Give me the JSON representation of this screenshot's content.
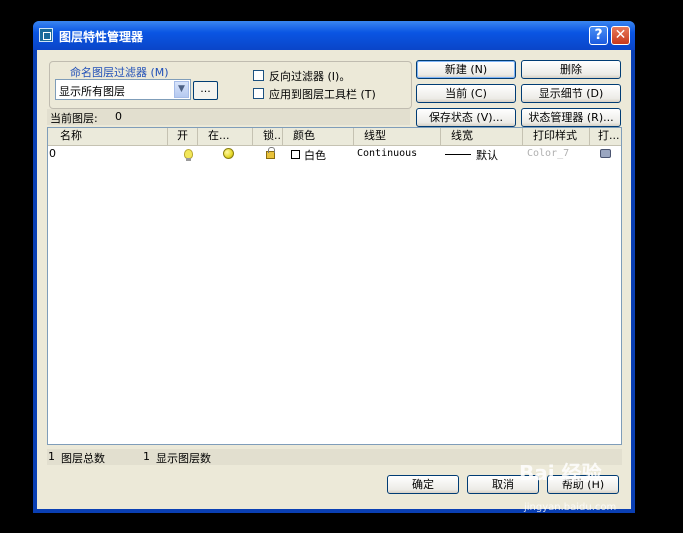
{
  "window": {
    "title": "图层特性管理器",
    "help_button": "?",
    "close_button": "✕"
  },
  "filter": {
    "group_label": "命名图层过滤器 (M)",
    "selected": "显示所有图层",
    "ellipsis": "...",
    "invert_label": "反向过滤器 (I)。",
    "apply_toolbar_label": "应用到图层工具栏 (T)"
  },
  "buttons": {
    "new": "新建 (N)",
    "delete": "删除",
    "current": "当前 (C)",
    "show_details": "显示细节 (D)",
    "save_state": "保存状态 (V)...",
    "state_manager": "状态管理器 (R)...",
    "ok": "确定",
    "cancel": "取消",
    "help": "帮助 (H)"
  },
  "current_layer": {
    "label": "当前图层:",
    "value": "0"
  },
  "table": {
    "columns": [
      "名称",
      "开",
      "在...",
      "锁...",
      "颜色",
      "线型",
      "线宽",
      "打印样式",
      "打..."
    ],
    "rows": [
      {
        "name": "0",
        "on": "bulb-icon",
        "freeze": "sun-icon",
        "lock": "lock-icon",
        "color": "白色",
        "linetype": "Continuous",
        "lineweight": "默认",
        "plotstyle": "Color_7",
        "plot": "printer-icon"
      }
    ]
  },
  "status": {
    "total_count": "1",
    "total_label": "图层总数",
    "shown_count": "1",
    "shown_label": "显示图层数"
  },
  "watermark": {
    "text": "Bai 经验",
    "url": "jingyan.baidu.com"
  }
}
